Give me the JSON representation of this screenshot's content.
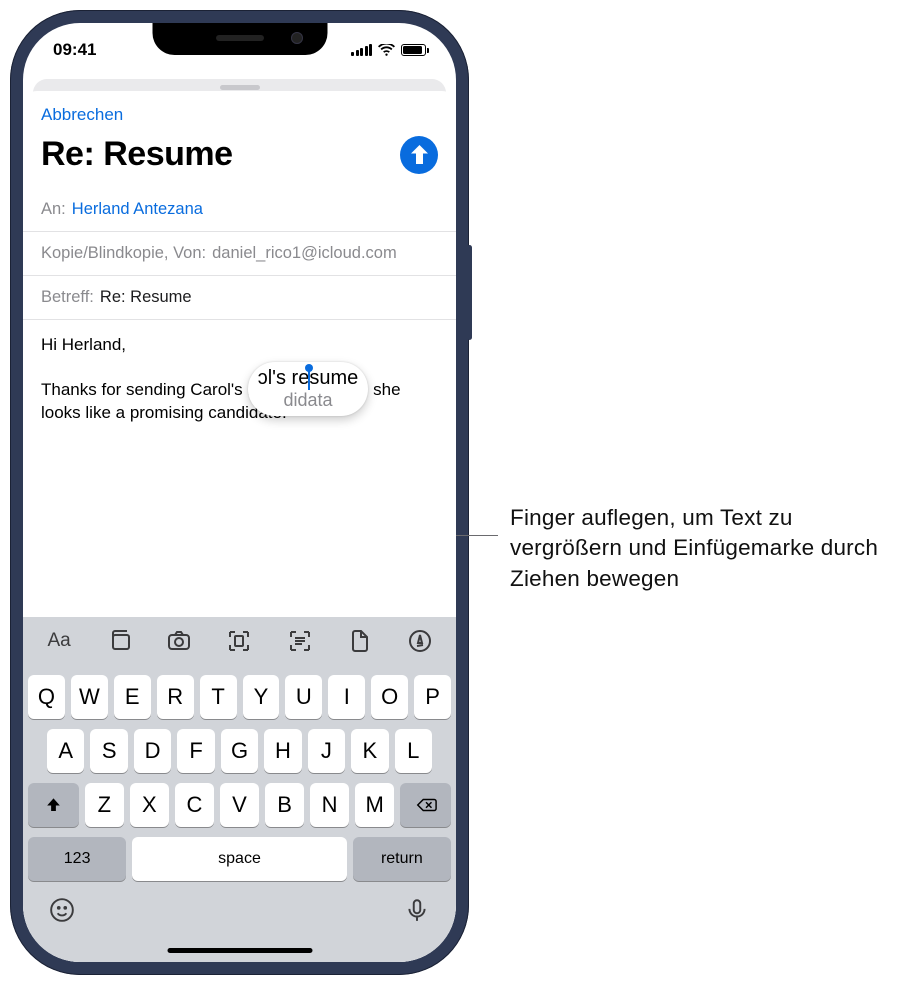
{
  "status": {
    "time": "09:41"
  },
  "compose": {
    "cancel": "Abbrechen",
    "title": "Re: Resume",
    "to_label": "An:",
    "to_recipient": "Herland Antezana",
    "cc_label": "Kopie/Blindkopie, Von:",
    "cc_value": "daniel_rico1@icloud.com",
    "subject_label": "Betreff:",
    "subject_value": "Re: Resume",
    "body_greeting": "Hi Herland,",
    "body_line_before": "Thanks for sending Carol's re",
    "body_line_after": "sumé I agree, she looks like a promising candidate.",
    "magnifier_line1": "ɔl's resume",
    "magnifier_line2": "didata"
  },
  "toolbar_icons": [
    "text-format",
    "photo-library",
    "camera",
    "scan-document",
    "scan-text",
    "attach-file",
    "markup"
  ],
  "keyboard": {
    "row1": [
      "Q",
      "W",
      "E",
      "R",
      "T",
      "Y",
      "U",
      "I",
      "O",
      "P"
    ],
    "row2": [
      "A",
      "S",
      "D",
      "F",
      "G",
      "H",
      "J",
      "K",
      "L"
    ],
    "row3": [
      "Z",
      "X",
      "C",
      "V",
      "B",
      "N",
      "M"
    ],
    "num": "123",
    "space": "space",
    "return": "return"
  },
  "callout": {
    "text": "Finger auflegen, um Text zu vergrößern und Einfügemarke durch Ziehen bewegen"
  }
}
